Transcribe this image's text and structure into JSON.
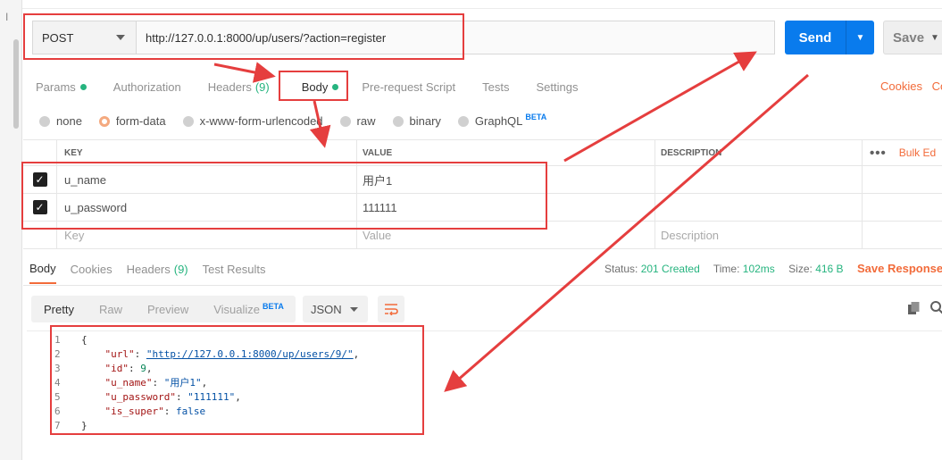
{
  "request": {
    "method": "POST",
    "url": "http://127.0.0.1:8000/up/users/?action=register",
    "send_label": "Send",
    "save_label": "Save"
  },
  "request_tabs": [
    {
      "label": "Params"
    },
    {
      "label": "Authorization"
    },
    {
      "label": "Headers",
      "count": "(9)"
    },
    {
      "label": "Body"
    },
    {
      "label": "Pre-request Script"
    },
    {
      "label": "Tests"
    },
    {
      "label": "Settings"
    }
  ],
  "tabs_right": {
    "cookies": "Cookies",
    "code": "Co"
  },
  "body_types": [
    {
      "label": "none"
    },
    {
      "label": "form-data"
    },
    {
      "label": "x-www-form-urlencoded"
    },
    {
      "label": "raw"
    },
    {
      "label": "binary"
    },
    {
      "label": "GraphQL",
      "beta": "BETA"
    }
  ],
  "table": {
    "headers": {
      "key": "KEY",
      "value": "VALUE",
      "description": "DESCRIPTION",
      "bulk": "Bulk Ed"
    },
    "rows": [
      {
        "key": "u_name",
        "value": "用户1"
      },
      {
        "key": "u_password",
        "value": "111111"
      }
    ],
    "placeholders": {
      "key": "Key",
      "value": "Value",
      "description": "Description"
    }
  },
  "response_tabs": [
    {
      "label": "Body"
    },
    {
      "label": "Cookies"
    },
    {
      "label": "Headers",
      "count": "(9)"
    },
    {
      "label": "Test Results"
    }
  ],
  "status": {
    "status_label": "Status:",
    "status_value": "201 Created",
    "time_label": "Time:",
    "time_value": "102ms",
    "size_label": "Size:",
    "size_value": "416 B",
    "save_response": "Save Response"
  },
  "view_modes": {
    "pretty": "Pretty",
    "raw": "Raw",
    "preview": "Preview",
    "visualize": "Visualize",
    "beta": "BETA"
  },
  "format": "JSON",
  "code_lines": [
    {
      "n": "1",
      "open": "{"
    },
    {
      "n": "2",
      "key": "\"url\"",
      "val": "\"http://127.0.0.1:8000/up/users/9/\"",
      "type": "url"
    },
    {
      "n": "3",
      "key": "\"id\"",
      "val": "9",
      "type": "num"
    },
    {
      "n": "4",
      "key": "\"u_name\"",
      "val": "\"用户1\"",
      "type": "str"
    },
    {
      "n": "5",
      "key": "\"u_password\"",
      "val": "\"111111\"",
      "type": "str"
    },
    {
      "n": "6",
      "key": "\"is_super\"",
      "val": "false",
      "type": "bool"
    },
    {
      "n": "7",
      "open": "}"
    }
  ],
  "annotation_color": "#e53e3e"
}
